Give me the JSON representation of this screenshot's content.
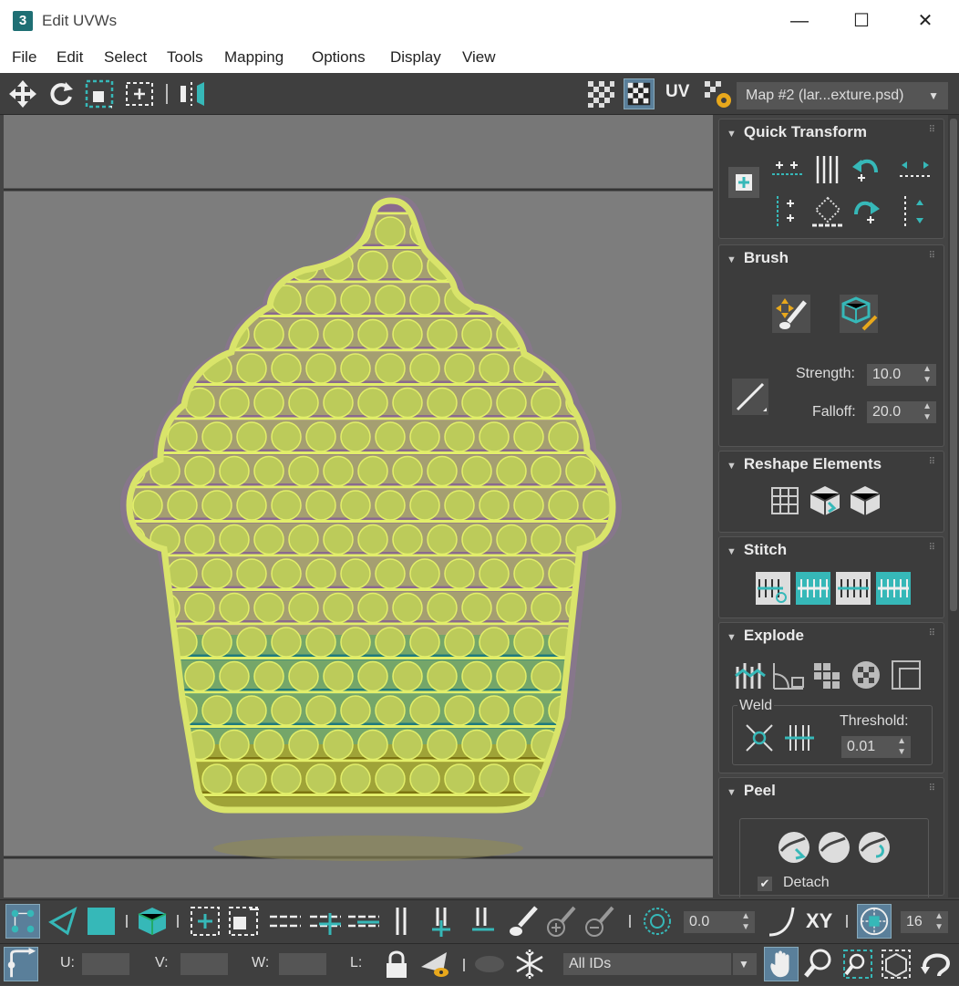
{
  "window": {
    "icon_text": "3",
    "title": "Edit UVWs",
    "minimize": "—",
    "maximize": "☐",
    "close": "✕"
  },
  "menu": [
    "File",
    "Edit",
    "Select",
    "Tools",
    "Mapping",
    "Options",
    "Display",
    "View"
  ],
  "toolbar": {
    "uv_label": "UV",
    "map_select": "Map #2 (lar...exture.psd)"
  },
  "rollouts": {
    "quick_transform": {
      "title": "Quick Transform"
    },
    "brush": {
      "title": "Brush",
      "strength_label": "Strength:",
      "strength_value": "10.0",
      "falloff_label": "Falloff:",
      "falloff_value": "20.0"
    },
    "reshape": {
      "title": "Reshape Elements"
    },
    "stitch": {
      "title": "Stitch"
    },
    "explode": {
      "title": "Explode",
      "weld_label": "Weld",
      "threshold_label": "Threshold:",
      "threshold_value": "0.01"
    },
    "peel": {
      "title": "Peel",
      "detach_label": "Detach",
      "detach_checked": "✔"
    }
  },
  "bottom": {
    "angle_value": "0.0",
    "xy_label": "XY",
    "grid_value": "16",
    "u_label": "U:",
    "v_label": "V:",
    "w_label": "W:",
    "l_label": "L:",
    "ids_select": "All IDs"
  },
  "colors": {
    "accent": "#36b8b8",
    "uv_fill": "#bccb5a",
    "uv_line": "#e2ee6a",
    "purple": "#8a6a8e",
    "teal": "#1f7b7d",
    "olive": "#7c7411"
  }
}
